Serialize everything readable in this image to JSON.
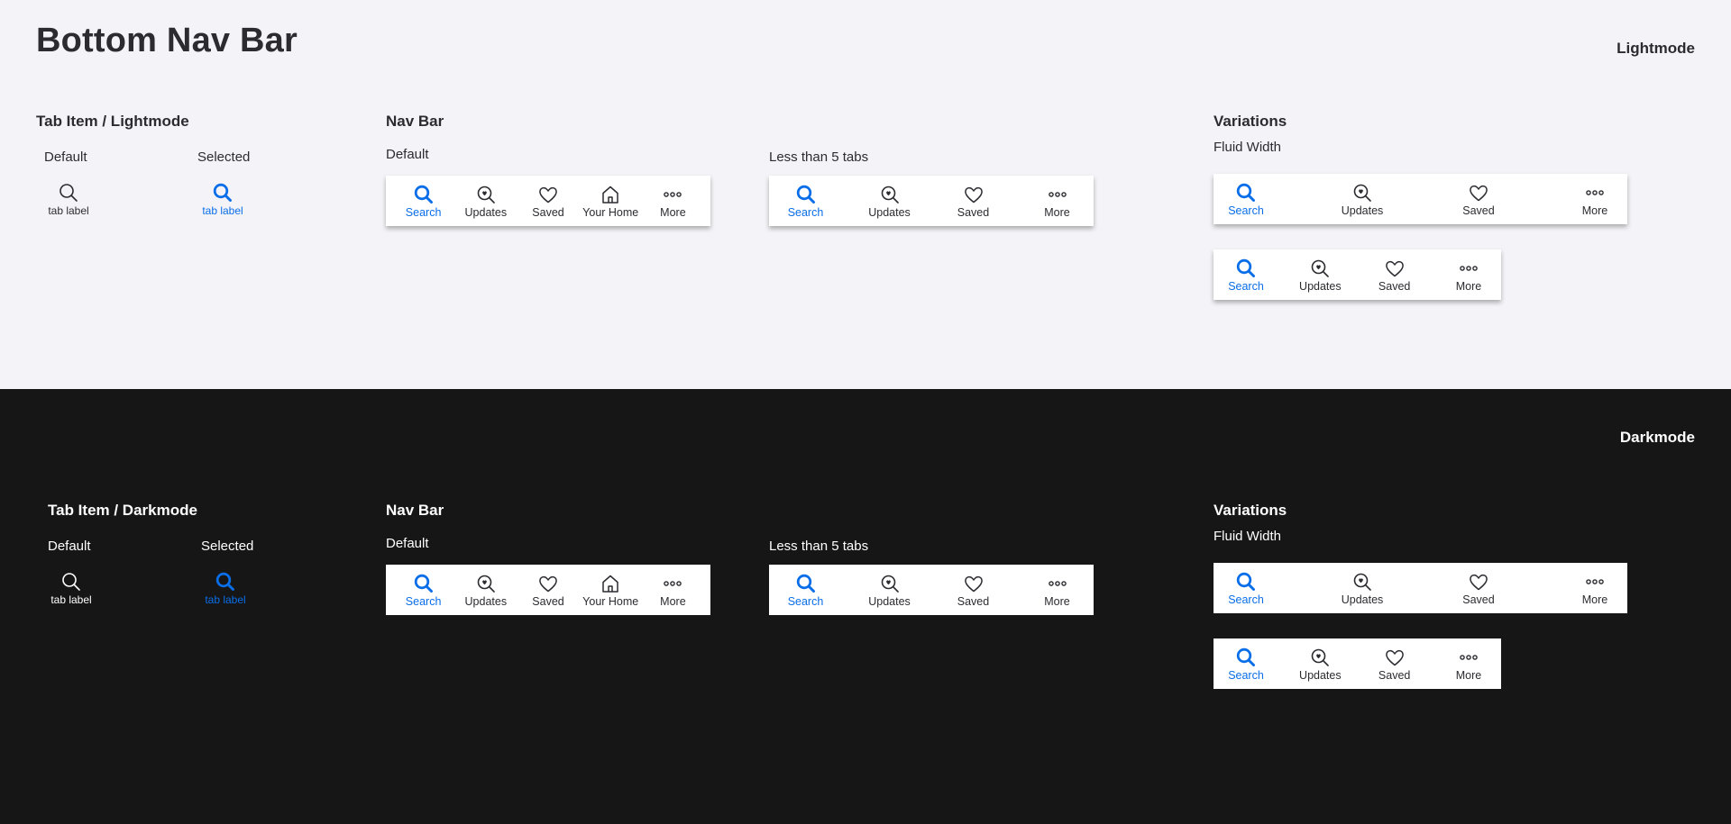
{
  "page": {
    "title": "Bottom Nav Bar"
  },
  "colors": {
    "accent": "#0a6ee8",
    "light_bg": "#f4f4f8",
    "dark_bg": "#161616",
    "bar_bg": "#ffffff",
    "text_dark": "#2b2b30"
  },
  "light": {
    "mode_label": "Lightmode",
    "tab_item": {
      "heading": "Tab Item / Lightmode",
      "default_label": "Default",
      "selected_label": "Selected",
      "tab_label": "tab label",
      "icon": "search-icon"
    },
    "nav_bar": {
      "heading": "Nav Bar",
      "default_label": "Default",
      "less_label": "Less than 5 tabs"
    },
    "variations": {
      "heading": "Variations",
      "fluid_label": "Fluid Width"
    }
  },
  "dark": {
    "mode_label": "Darkmode",
    "tab_item": {
      "heading": "Tab Item / Darkmode",
      "default_label": "Default",
      "selected_label": "Selected",
      "tab_label": "tab label",
      "icon": "search-icon"
    },
    "nav_bar": {
      "heading": "Nav Bar",
      "default_label": "Default",
      "less_label": "Less than 5 tabs"
    },
    "variations": {
      "heading": "Variations",
      "fluid_label": "Fluid Width"
    }
  },
  "tabs": {
    "search": {
      "label": "Search",
      "icon": "search-icon"
    },
    "updates": {
      "label": "Updates",
      "icon": "updates-icon"
    },
    "saved": {
      "label": "Saved",
      "icon": "heart-icon"
    },
    "home": {
      "label": "Your Home",
      "icon": "home-icon"
    },
    "more": {
      "label": "More",
      "icon": "more-icon"
    }
  }
}
